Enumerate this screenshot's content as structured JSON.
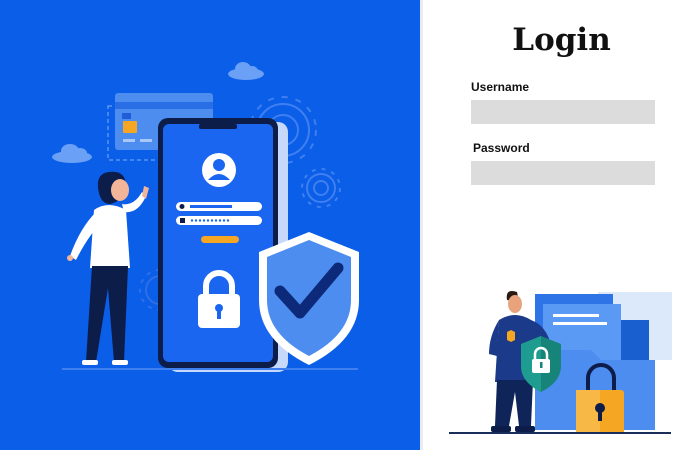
{
  "login": {
    "title": "Login",
    "username_label": "Username",
    "username_value": "",
    "password_label": "Password",
    "password_value": ""
  },
  "colors": {
    "left_bg": "#0a5ee8",
    "field_bg": "#dcdcdc",
    "shield": "#4d8df0",
    "lock_orange": "#f5a623",
    "teal_shield": "#17847a"
  },
  "icons": [
    "cloud-icon",
    "credit-card-icon",
    "gear-icon",
    "user-avatar-icon",
    "lock-icon",
    "shield-check-icon",
    "police-officer-figure",
    "padlock-icon",
    "document-icon"
  ]
}
